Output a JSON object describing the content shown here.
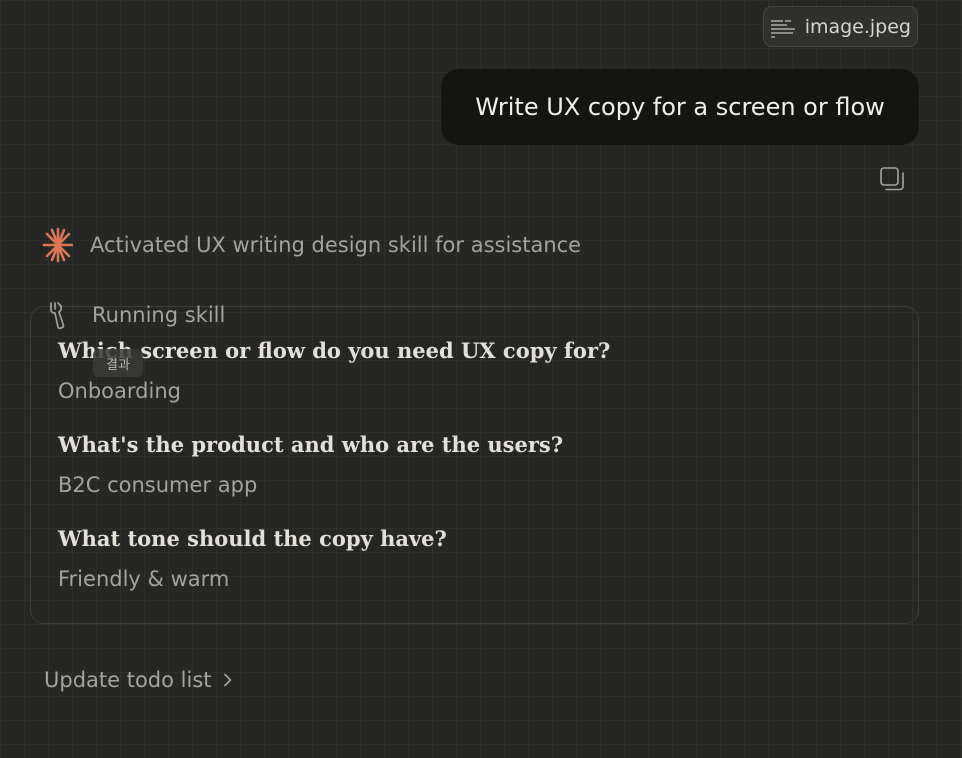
{
  "attachment": {
    "filename": "image.jpeg",
    "icon": "image-thumbnail-icon"
  },
  "user_message": {
    "text": "Write UX copy for a screen or flow"
  },
  "actions": {
    "copy_icon": "copy-icon"
  },
  "assistant": {
    "status_icon": "sparkle-icon",
    "status_text": "Activated UX writing design skill for assistance",
    "tool_icon": "wrench-icon",
    "tool_label": "Running skill",
    "tooltip": "결과"
  },
  "results": {
    "items": [
      {
        "question": "Which screen or flow do you need UX copy for?",
        "answer": "Onboarding"
      },
      {
        "question": "What's the product and who are the users?",
        "answer": "B2C consumer app"
      },
      {
        "question": "What tone should the copy have?",
        "answer": "Friendly & warm"
      }
    ]
  },
  "todo": {
    "label": "Update todo list",
    "icon": "chevron-right-icon"
  },
  "colors": {
    "background": "#262624",
    "accent": "#d97757",
    "user_bubble": "#141413",
    "muted_text": "#a5a39c"
  }
}
